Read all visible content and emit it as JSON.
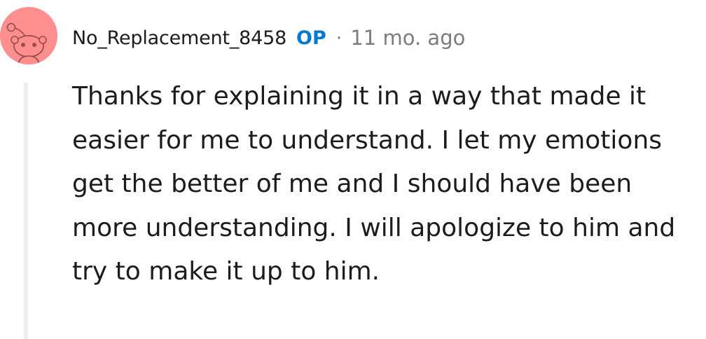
{
  "comment": {
    "author": "No_Replacement_8458",
    "op_badge": "OP",
    "separator": "·",
    "timestamp": "11 mo. ago",
    "body": "Thanks for explaining it in a way that made it easier for me to understand. I let my emotions get the better of me and I should have been more understanding. I will apologize to him and try to make it up to him.",
    "avatar_icon": "snoo-avatar-icon",
    "avatar_color": "#ff8f8f"
  },
  "colors": {
    "username": "#1c1c1c",
    "op_badge": "#0079d3",
    "meta": "#7c7c7c",
    "thread_line": "#edeff1"
  }
}
